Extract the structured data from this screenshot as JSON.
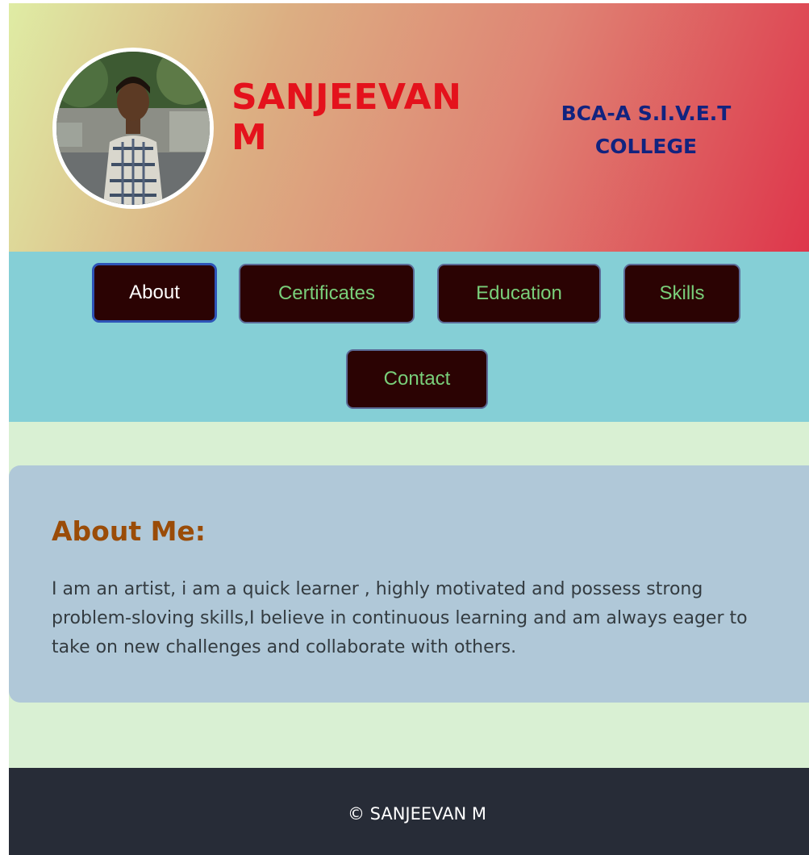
{
  "header": {
    "name": "SANJEEVAN M",
    "college": "BCA-A S.I.V.E.T COLLEGE"
  },
  "nav": {
    "items": [
      {
        "label": "About",
        "active": true
      },
      {
        "label": "Certificates",
        "active": false
      },
      {
        "label": "Education",
        "active": false
      },
      {
        "label": "Skills",
        "active": false
      },
      {
        "label": "Contact",
        "active": false
      }
    ]
  },
  "about": {
    "heading": "About Me:",
    "text": "I am an artist, i am a quick learner , highly motivated and possess strong problem-sloving skills,I believe in continuous learning and am always eager to take on new challenges and collaborate with others."
  },
  "footer": {
    "copyright": "© SANJEEVAN M"
  },
  "colors": {
    "name": "#e4121c",
    "college": "#11237f",
    "nav_background": "#85cfd6",
    "nav_button": "#2b0303",
    "nav_text": "#79cf7a",
    "about_card": "#b0c8d8",
    "about_heading": "#9a4c08",
    "page_background": "#d9f0d3",
    "footer": "#272c37"
  }
}
